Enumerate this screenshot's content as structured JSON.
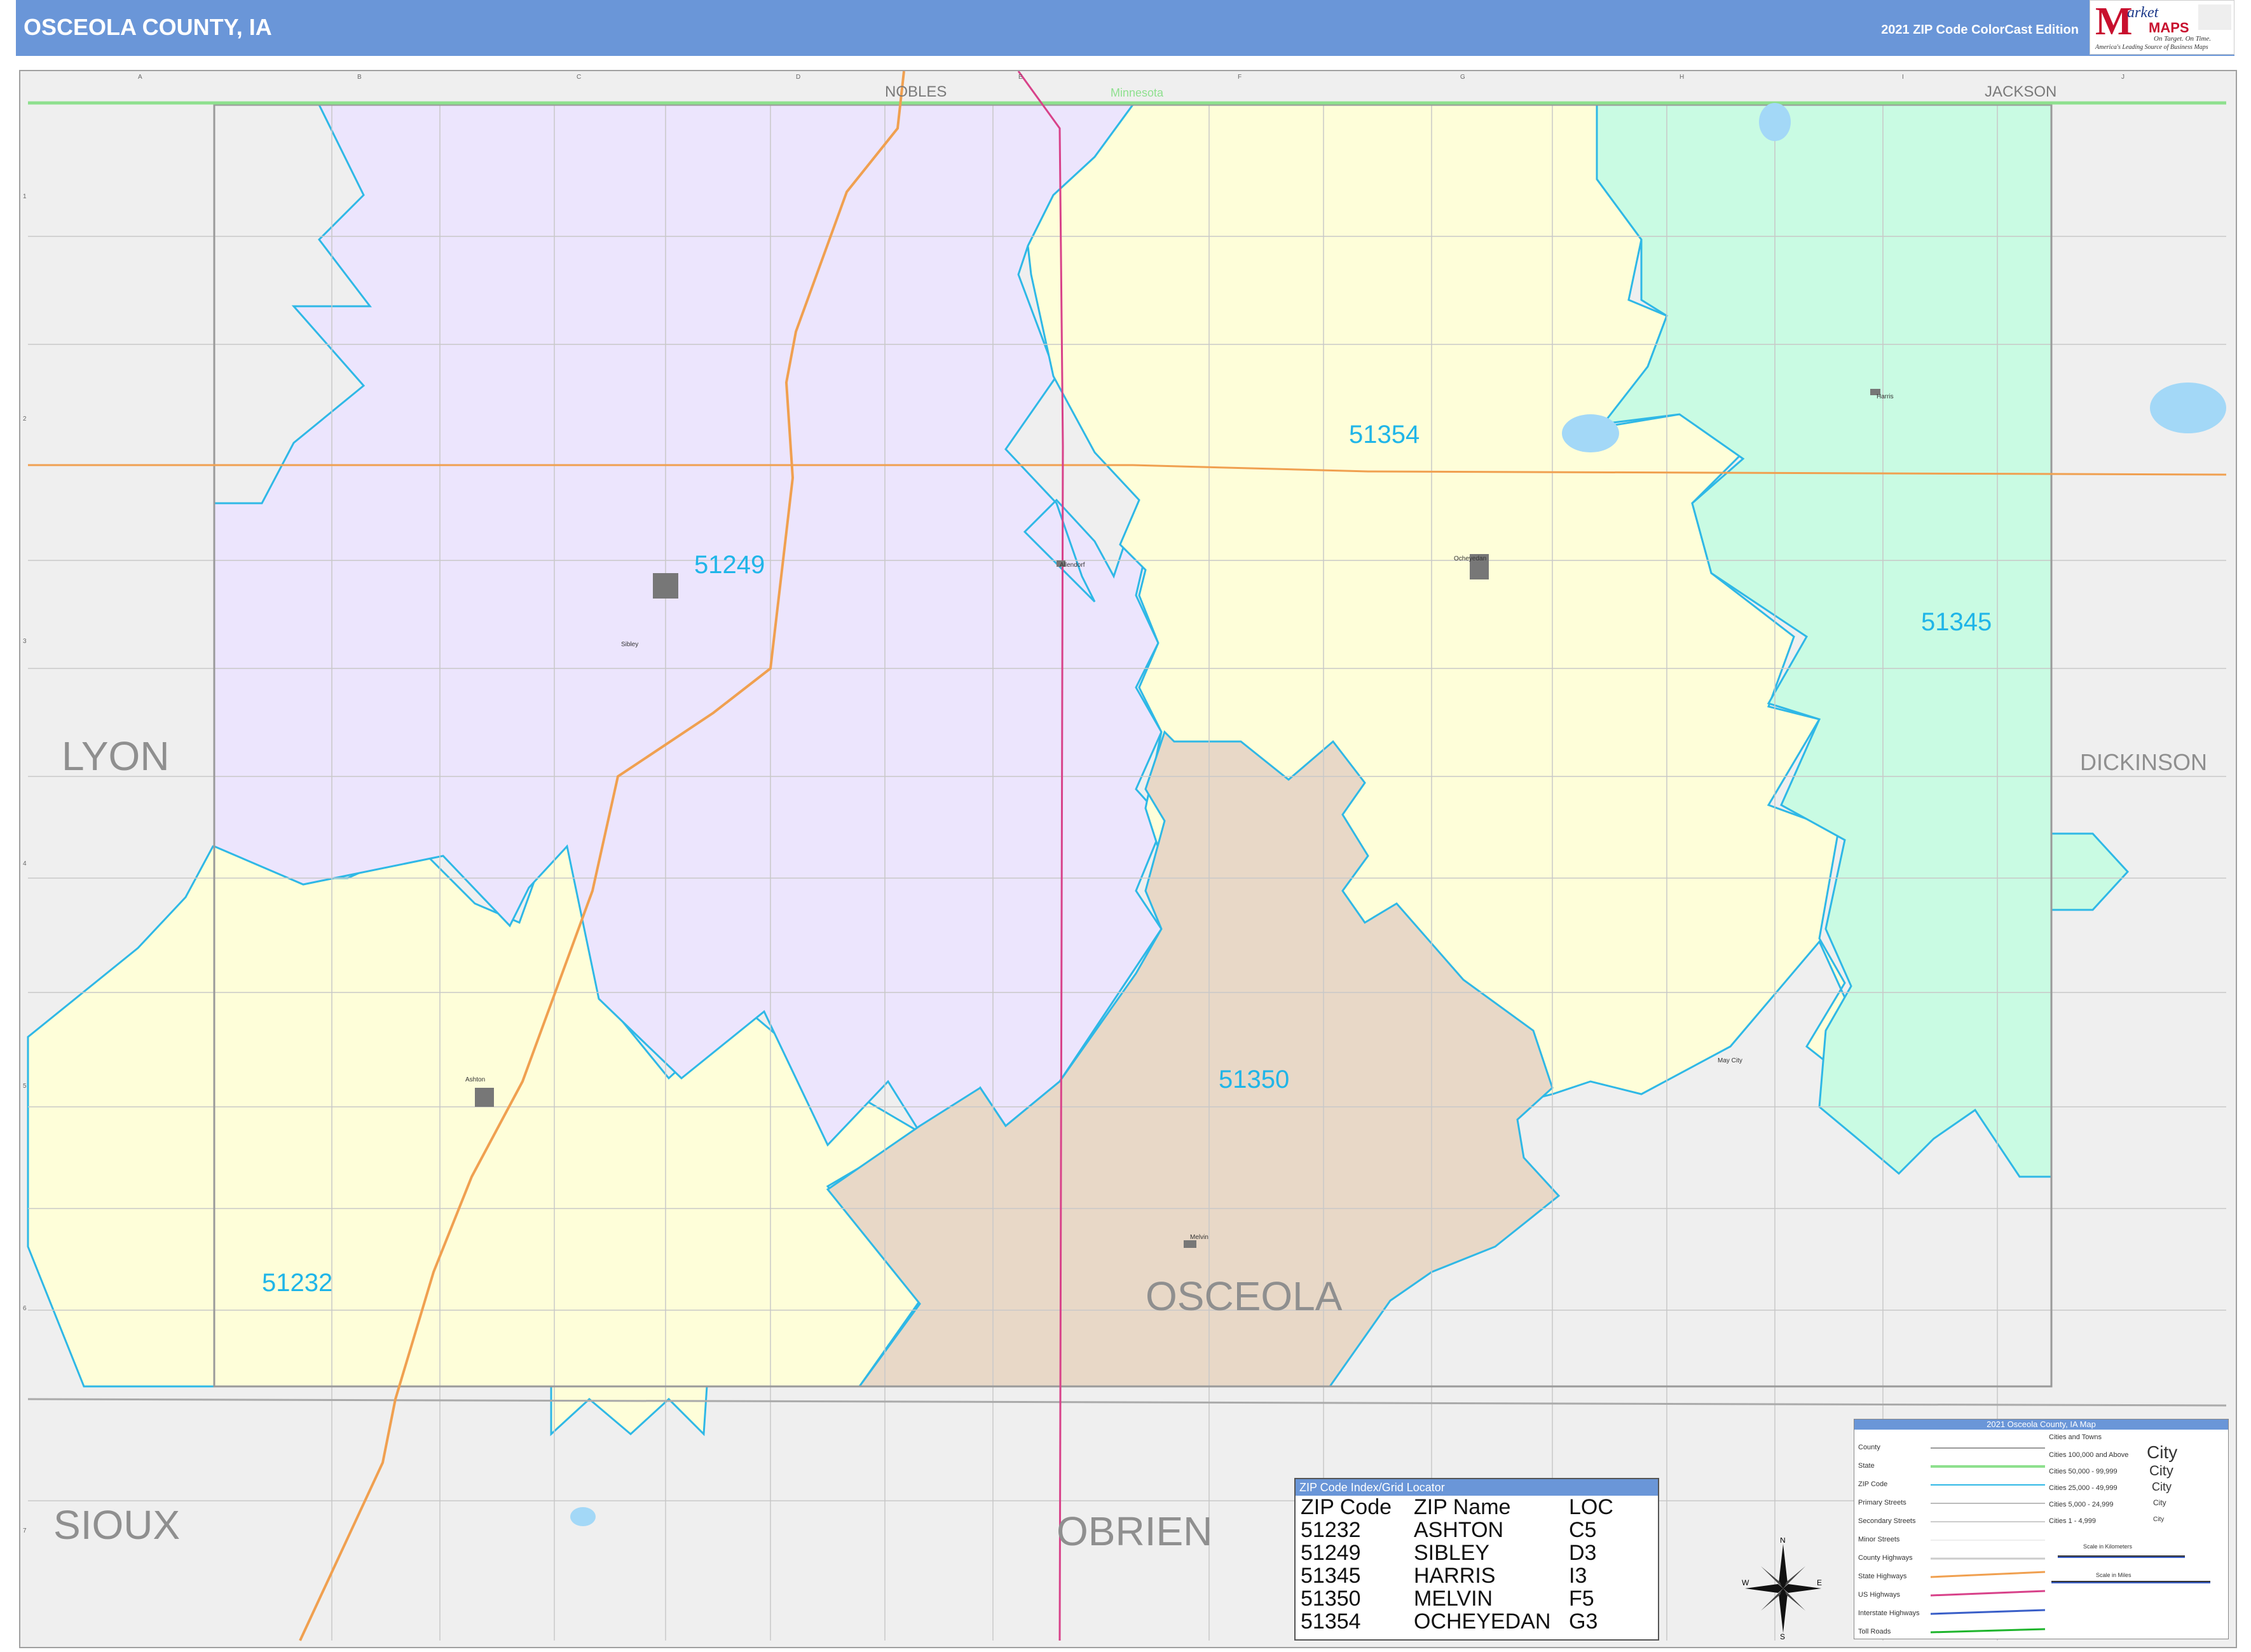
{
  "header": {
    "title": "OSCEOLA COUNTY, IA",
    "edition": "2021 ZIP Code ColorCast Edition"
  },
  "logo": {
    "brand_m": "M",
    "brand_market": "arket",
    "brand_maps": "MAPS",
    "tagline1": "On Target. On Time.",
    "tagline2": "America's Leading Source of Business Maps"
  },
  "map": {
    "grid_columns": [
      "A",
      "B",
      "C",
      "D",
      "E",
      "F",
      "G",
      "H",
      "I",
      "J"
    ],
    "grid_rows": [
      "1",
      "2",
      "3",
      "4",
      "5",
      "6",
      "7"
    ],
    "neighbors": {
      "north_left": "NOBLES",
      "north_center": "Minnesota",
      "north_right": "JACKSON",
      "west": "LYON",
      "east": "DICKINSON",
      "southwest": "SIOUX",
      "south": "OBRIEN"
    },
    "county_label": "OSCEOLA",
    "zip_areas": [
      {
        "zip": "51249",
        "color": "#ece5fd"
      },
      {
        "zip": "51354",
        "color": "#fefed9"
      },
      {
        "zip": "51345",
        "color": "#c9fbe3"
      },
      {
        "zip": "51350",
        "color": "#e8d8c7"
      },
      {
        "zip": "51232",
        "color": "#fefed9"
      }
    ],
    "towns": [
      "Sibley",
      "Ocheyedan",
      "Harris",
      "Allendorf",
      "Ashton",
      "Melvin",
      "May City"
    ],
    "colors": {
      "zip_boundary": "#2fb8e6",
      "state_line": "#8ee08e",
      "highway": "#f0a050",
      "us_highway": "#d8428a",
      "water": "#a3d8f7",
      "outside": "#efefef"
    }
  },
  "zip_index": {
    "title": "ZIP Code Index/Grid Locator",
    "headers": [
      "ZIP Code",
      "ZIP Name",
      "LOC"
    ],
    "rows": [
      {
        "zip": "51232",
        "name": "ASHTON",
        "loc": "C5"
      },
      {
        "zip": "51249",
        "name": "SIBLEY",
        "loc": "D3"
      },
      {
        "zip": "51345",
        "name": "HARRIS",
        "loc": "I3"
      },
      {
        "zip": "51350",
        "name": "MELVIN",
        "loc": "F5"
      },
      {
        "zip": "51354",
        "name": "OCHEYEDAN",
        "loc": "G3"
      }
    ]
  },
  "legend": {
    "title": "2021 Osceola County, IA Map",
    "items": [
      "County",
      "State",
      "ZIP Code",
      "Primary Streets",
      "Secondary Streets",
      "Minor Streets",
      "County Highways",
      "State Highways",
      "US Highways",
      "Interstate Highways",
      "Toll Roads"
    ],
    "cities_header": "Cities and Towns",
    "cities": [
      "Cities 100,000 and Above",
      "Cities 50,000 - 99,999",
      "Cities 25,000 - 49,999",
      "Cities 5,000 - 24,999",
      "Cities 1 - 4,999"
    ],
    "city_samples": [
      "City",
      "City",
      "City",
      "City",
      "City"
    ],
    "scale_km": "Scale in Kilometers",
    "scale_mi": "Scale in Miles"
  },
  "compass": {
    "n": "N",
    "s": "S",
    "e": "E",
    "w": "W"
  }
}
